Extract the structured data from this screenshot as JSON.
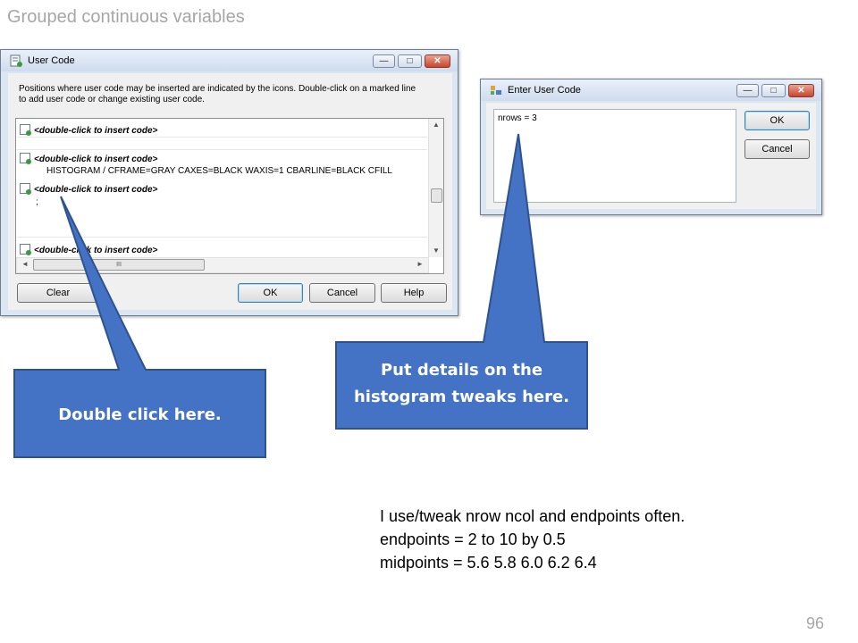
{
  "slide": {
    "title": "Grouped continuous variables",
    "page_number": "96"
  },
  "user_code_window": {
    "title": "User Code",
    "description_line1": "Positions where user code may be inserted are indicated by the icons. Double-click on a marked line",
    "description_line2": "to add user code or change existing user code.",
    "rows": [
      {
        "text": "<double-click to insert code>",
        "marked": true
      },
      {
        "text": "<double-click to insert code>",
        "marked": true
      },
      {
        "text": "HISTOGRAM /     CFRAME=GRAY CAXES=BLACK WAXIS=1  CBARLINE=BLACK CFILL",
        "marked": false
      },
      {
        "text": "<double-click to insert code>",
        "marked": true
      },
      {
        "text": ";",
        "marked": false
      },
      {
        "text": "<double-click to insert code>",
        "marked": true
      }
    ],
    "buttons": {
      "clear": "Clear",
      "ok": "OK",
      "cancel": "Cancel",
      "help": "Help"
    },
    "scrollbar_glyphs": {
      "up": "▲",
      "down": "▼",
      "left": "◄",
      "right": "►",
      "grip": "III"
    }
  },
  "enter_user_code_window": {
    "title": "Enter User Code",
    "code_value": "nrows = 3",
    "buttons": {
      "ok": "OK",
      "cancel": "Cancel"
    }
  },
  "window_controls": {
    "minimize": "—",
    "maximize": "□",
    "close": "✕"
  },
  "callouts": {
    "left": "Double click here.",
    "right_line1": "Put details on the",
    "right_line2": "histogram tweaks here.",
    "fill": "#4472c4",
    "stroke": "#2f528f"
  },
  "notes": {
    "line1": "I use/tweak nrow ncol and endpoints often.",
    "line2": "endpoints = 2 to 10 by 0.5",
    "line3": "midpoints = 5.6 5.8 6.0 6.2 6.4"
  }
}
